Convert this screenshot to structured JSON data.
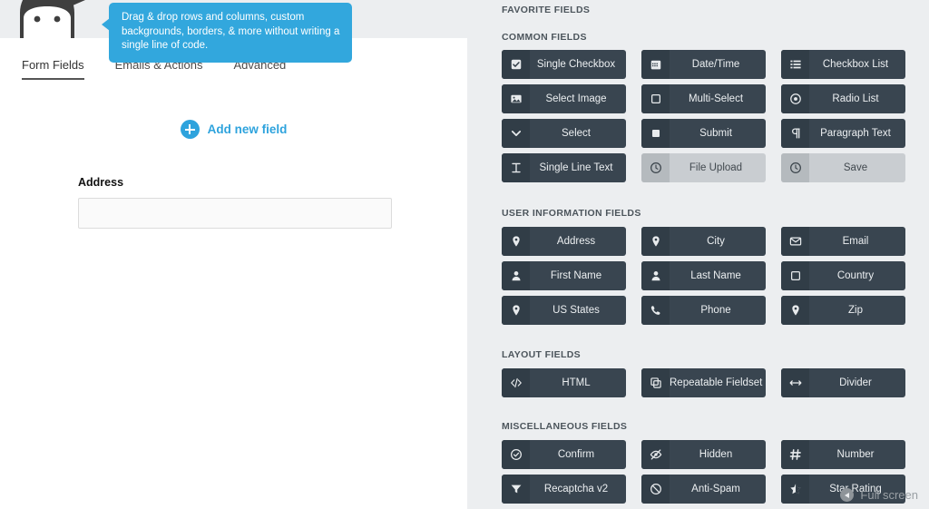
{
  "brand": {
    "logo_name": "ninja-forms-logo"
  },
  "tooltip": {
    "text": "Drag & drop rows and columns, custom backgrounds, borders, & more without writing a single line of code.",
    "color": "#32a7dd"
  },
  "tabs": [
    {
      "label": "Form Fields",
      "active": true
    },
    {
      "label": "Emails & Actions",
      "active": false
    },
    {
      "label": "Advanced",
      "active": false
    }
  ],
  "builder": {
    "add_new_field_label": "Add new field",
    "accent_color": "#2ea3dd",
    "fields": [
      {
        "label": "Address",
        "value": "",
        "placeholder": ""
      }
    ]
  },
  "sidebar": {
    "favorite_title": "FAVORITE FIELDS",
    "sections": [
      {
        "title": "COMMON FIELDS",
        "items": [
          {
            "label": "Single Checkbox",
            "icon": "checkbox-checked-icon",
            "disabled": false
          },
          {
            "label": "Date/Time",
            "icon": "calendar-icon",
            "disabled": false
          },
          {
            "label": "Checkbox List",
            "icon": "list-icon",
            "disabled": false
          },
          {
            "label": "Select Image",
            "icon": "image-icon",
            "disabled": false
          },
          {
            "label": "Multi-Select",
            "icon": "square-outline-icon",
            "disabled": false
          },
          {
            "label": "Radio List",
            "icon": "radio-icon",
            "disabled": false
          },
          {
            "label": "Select",
            "icon": "chevron-down-icon",
            "disabled": false
          },
          {
            "label": "Submit",
            "icon": "square-filled-icon",
            "disabled": false
          },
          {
            "label": "Paragraph Text",
            "icon": "pilcrow-icon",
            "disabled": false
          },
          {
            "label": "Single Line Text",
            "icon": "text-cursor-icon",
            "disabled": false
          },
          {
            "label": "File Upload",
            "icon": "upload-clock-icon",
            "disabled": true
          },
          {
            "label": "Save",
            "icon": "upload-clock-icon",
            "disabled": true
          }
        ]
      },
      {
        "title": "USER INFORMATION FIELDS",
        "items": [
          {
            "label": "Address",
            "icon": "map-pin-icon",
            "disabled": false
          },
          {
            "label": "City",
            "icon": "map-pin-icon",
            "disabled": false
          },
          {
            "label": "Email",
            "icon": "envelope-icon",
            "disabled": false
          },
          {
            "label": "First Name",
            "icon": "user-icon",
            "disabled": false
          },
          {
            "label": "Last Name",
            "icon": "user-icon",
            "disabled": false
          },
          {
            "label": "Country",
            "icon": "square-outline-icon",
            "disabled": false
          },
          {
            "label": "US States",
            "icon": "map-pin-icon",
            "disabled": false
          },
          {
            "label": "Phone",
            "icon": "phone-icon",
            "disabled": false
          },
          {
            "label": "Zip",
            "icon": "map-pin-icon",
            "disabled": false
          }
        ]
      },
      {
        "title": "LAYOUT FIELDS",
        "items": [
          {
            "label": "HTML",
            "icon": "code-icon",
            "disabled": false
          },
          {
            "label": "Repeatable Fieldset",
            "icon": "copy-icon",
            "disabled": false
          },
          {
            "label": "Divider",
            "icon": "arrows-h-icon",
            "disabled": false
          }
        ]
      },
      {
        "title": "MISCELLANEOUS FIELDS",
        "items": [
          {
            "label": "Confirm",
            "icon": "check-circle-icon",
            "disabled": false
          },
          {
            "label": "Hidden",
            "icon": "eye-slash-icon",
            "disabled": false
          },
          {
            "label": "Number",
            "icon": "hash-icon",
            "disabled": false
          },
          {
            "label": "Recaptcha v2",
            "icon": "filter-icon",
            "disabled": false
          },
          {
            "label": "Anti-Spam",
            "icon": "ban-icon",
            "disabled": false
          },
          {
            "label": "Star Rating",
            "icon": "star-half-icon",
            "disabled": false
          }
        ]
      }
    ]
  },
  "overlay": {
    "fullscreen_label": "Full screen",
    "fullscreen_icon": "play-back-icon"
  }
}
